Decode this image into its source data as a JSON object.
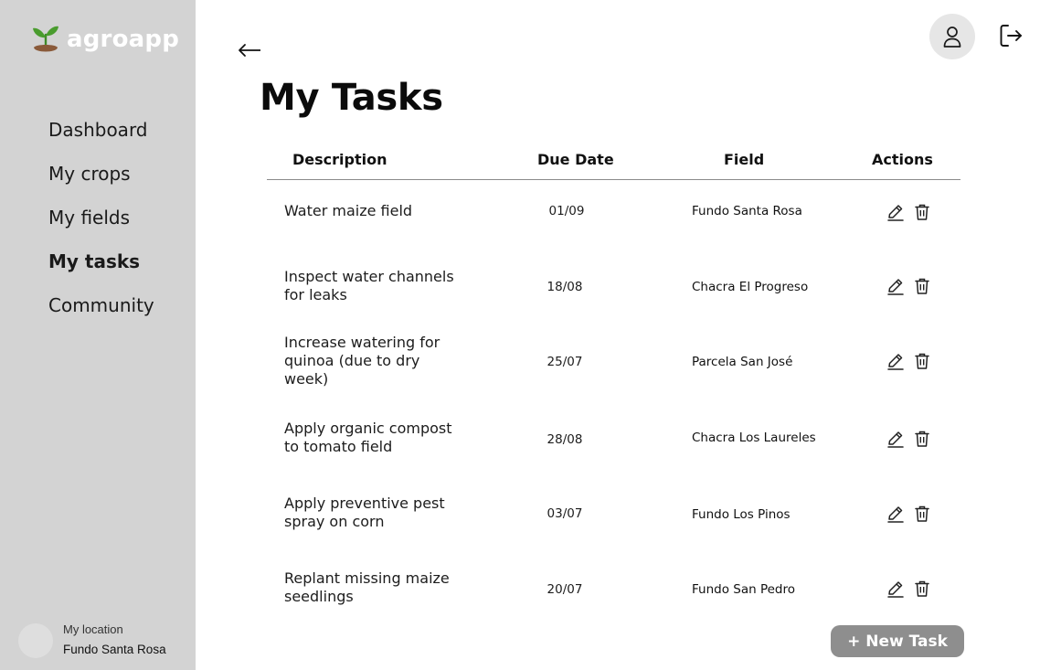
{
  "app": {
    "name": "agroapp"
  },
  "sidebar": {
    "items": [
      {
        "label": "Dashboard",
        "active": false
      },
      {
        "label": "My crops",
        "active": false
      },
      {
        "label": "My fields",
        "active": false
      },
      {
        "label": "My tasks",
        "active": true
      },
      {
        "label": "Community",
        "active": false
      }
    ],
    "location": {
      "label": "My location",
      "value": "Fundo Santa Rosa"
    }
  },
  "header": {
    "back_icon": "arrow-left-icon",
    "profile_icon": "user-icon",
    "logout_icon": "logout-icon"
  },
  "page": {
    "title": "My Tasks"
  },
  "table": {
    "columns": [
      "Description",
      "Due Date",
      "Field",
      "Actions"
    ],
    "rows": [
      {
        "description": "Water maize field",
        "due_date": "01/09",
        "field": "Fundo Santa Rosa"
      },
      {
        "description": "Inspect water channels for leaks",
        "due_date": "18/08",
        "field": "Chacra El Progreso"
      },
      {
        "description": "Increase watering for quinoa (due to dry week)",
        "due_date": "25/07",
        "field": "Parcela San José"
      },
      {
        "description": "Apply organic compost to tomato field",
        "due_date": "28/08",
        "field": "Chacra Los Laureles"
      },
      {
        "description": "Apply preventive pest spray on corn",
        "due_date": "03/07",
        "field": "Fundo Los Pinos"
      },
      {
        "description": "Replant missing maize seedlings",
        "due_date": "20/07",
        "field": "Fundo San Pedro"
      }
    ],
    "action_icons": [
      "edit-icon",
      "trash-icon"
    ]
  },
  "actions": {
    "new_task_label": "+ New Task"
  },
  "colors": {
    "sidebar_bg": "#d3d3d3",
    "button_bg": "#8e8e8e",
    "leaf_green": "#4a9c2e",
    "soil_brown": "#8a5a3a"
  }
}
